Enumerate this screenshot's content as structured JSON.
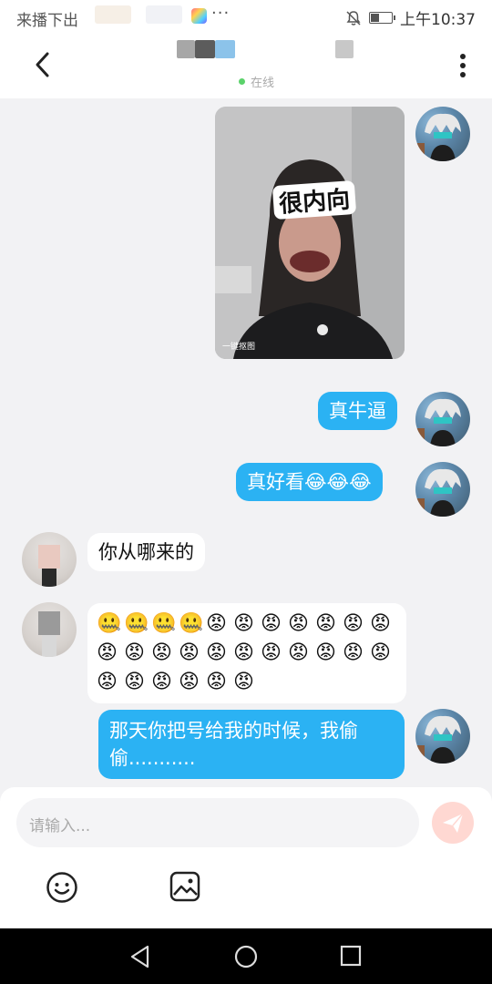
{
  "status_bar": {
    "left_text": "来播下出",
    "time": "上午10:37"
  },
  "header": {
    "presence": "在线",
    "back_icon": "chevron-left-icon",
    "more_icon": "more-vertical-icon"
  },
  "messages": [
    {
      "side": "me",
      "type": "image",
      "sticker_text": "很内向",
      "watermark": "一键抠图"
    },
    {
      "side": "me",
      "type": "text",
      "text": "真牛逼"
    },
    {
      "side": "me",
      "type": "text",
      "text": "真好看😂😂😂"
    },
    {
      "side": "other",
      "type": "text",
      "text": "你从哪来的"
    },
    {
      "side": "other",
      "type": "emoji",
      "emojis": [
        "🤐",
        "🤐",
        "🤐",
        "🤐",
        "😡",
        "😡",
        "😡",
        "😡",
        "😡",
        "😡",
        "😡",
        "😡",
        "😡",
        "😡",
        "😡",
        "😡",
        "😡",
        "😡",
        "😡",
        "😡",
        "😡",
        "😡",
        "😡",
        "😡",
        "😡",
        "😡",
        "😡",
        "😡"
      ]
    },
    {
      "side": "me",
      "type": "text",
      "text": "那天你把号给我的时候，我偷偷..........."
    }
  ],
  "composer": {
    "placeholder": "请输入...",
    "send_icon": "send-icon",
    "emoji_icon": "smiley-icon",
    "image_icon": "image-icon"
  },
  "navigation": {
    "back": "triangle-back-icon",
    "home": "circle-home-icon",
    "recents": "square-recents-icon"
  },
  "colors": {
    "my_bubble": "#2bb2f3",
    "other_bubble": "#ffffff",
    "chat_bg": "#f2f2f4",
    "online_dot": "#5bd26b",
    "send_button": "#ffd8d2"
  }
}
